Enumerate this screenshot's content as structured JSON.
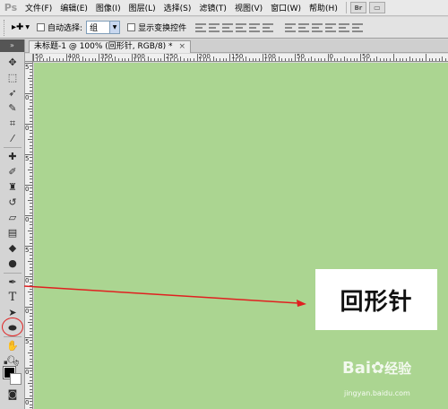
{
  "app": {
    "logo": "Ps"
  },
  "menu": {
    "items": [
      {
        "label": "文件(F)"
      },
      {
        "label": "编辑(E)"
      },
      {
        "label": "图像(I)"
      },
      {
        "label": "图层(L)"
      },
      {
        "label": "选择(S)"
      },
      {
        "label": "滤镜(T)"
      },
      {
        "label": "视图(V)"
      },
      {
        "label": "窗口(W)"
      },
      {
        "label": "帮助(H)"
      }
    ],
    "bridge_button": "Br"
  },
  "options": {
    "auto_select_label": "自动选择:",
    "auto_select_value": "组",
    "show_transform_label": "显示变换控件"
  },
  "document": {
    "tab_title": "未标题-1 @ 100% (回形针, RGB/8) *",
    "close_mark": "×"
  },
  "ruler": {
    "top_labels": [
      "50",
      "400",
      "350",
      "300",
      "250",
      "200",
      "150",
      "100",
      "50",
      "0",
      "50"
    ],
    "left_labels": [
      "5",
      "0",
      "0",
      "5",
      "0",
      "0",
      "5",
      "0",
      "0",
      "5",
      "0",
      "0"
    ]
  },
  "callout": {
    "text": "回形针"
  },
  "watermark": {
    "brand": "Bai",
    "brand_suffix": "经验",
    "url": "jingyan.baidu.com"
  },
  "colors": {
    "canvas": "#abd591",
    "foreground": "#000000",
    "background": "#ffffff",
    "annotation": "#e02020"
  },
  "icons": {
    "active_tool": "type-tool-icon"
  }
}
